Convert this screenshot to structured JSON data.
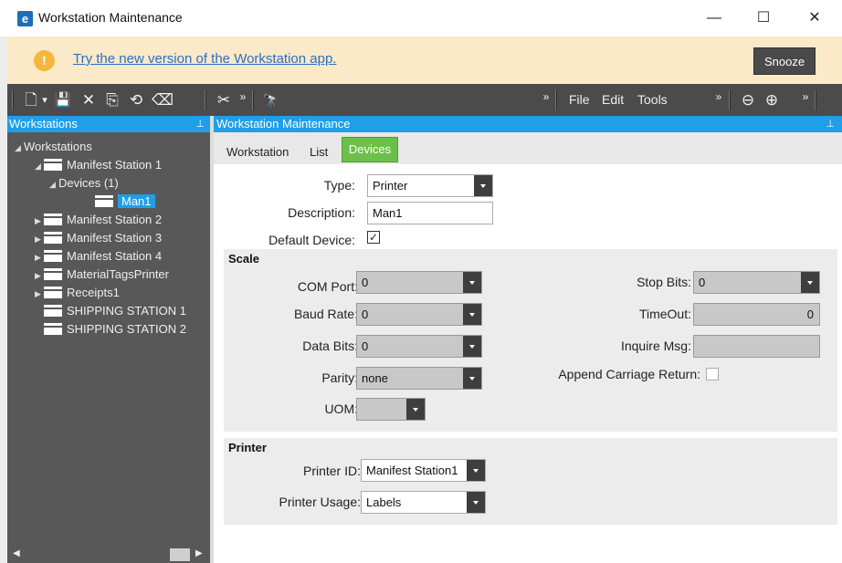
{
  "window": {
    "title": "Workstation Maintenance",
    "logo_letter": "e",
    "minimize": "—",
    "maximize": "☐",
    "close": "✕"
  },
  "notification": {
    "icon": "!",
    "link_text": "Try the new version of the Workstation app.",
    "snooze_label": "Snooze"
  },
  "toolbar": {
    "new_icon": "🗋",
    "dropdown_icon": "▾",
    "save_icon": "💾",
    "delete_icon": "✕",
    "copy_icon": "⎘",
    "refresh_icon": "⟲",
    "clear_icon": "⌫",
    "cut_icon": "✂",
    "overflow1": "»",
    "find_icon": "🔭",
    "overflow2": "»",
    "menu": [
      "File",
      "Edit",
      "Tools"
    ],
    "overflow3": "»",
    "back_icon": "⊖",
    "forward_icon": "⊕",
    "overflow4": "»"
  },
  "workstations_panel": {
    "title": "Workstations",
    "pin": "⊥",
    "tree": [
      {
        "label": "Workstations",
        "level": 0,
        "expand": "◢",
        "folder": false
      },
      {
        "label": "Manifest Station 1",
        "level": 1,
        "expand": "◢",
        "folder": true
      },
      {
        "label": "Devices (1)",
        "level": 2,
        "expand": "◢",
        "folder": false
      },
      {
        "label": "Man1",
        "level": 3,
        "expand": "",
        "folder": true,
        "selected": true
      },
      {
        "label": "Manifest Station 2",
        "level": 1,
        "expand": "▶",
        "folder": true
      },
      {
        "label": "Manifest Station 3",
        "level": 1,
        "expand": "▶",
        "folder": true
      },
      {
        "label": "Manifest Station 4",
        "level": 1,
        "expand": "▶",
        "folder": true
      },
      {
        "label": "MaterialTagsPrinter",
        "level": 1,
        "expand": "▶",
        "folder": true
      },
      {
        "label": "Receipts1",
        "level": 1,
        "expand": "▶",
        "folder": true
      },
      {
        "label": "SHIPPING STATION 1",
        "level": 1,
        "expand": "",
        "folder": true
      },
      {
        "label": "SHIPPING STATION 2",
        "level": 1,
        "expand": "",
        "folder": true
      }
    ],
    "scroll_left": "◀",
    "scroll_right": "▶"
  },
  "maintenance_panel": {
    "title": "Workstation Maintenance",
    "pin": "⊥",
    "tabs": {
      "workstation": "Workstation",
      "list": "List",
      "devices": "Devices"
    },
    "form": {
      "type_label": "Type:",
      "type_value": "Printer",
      "description_label": "Description:",
      "description_value": "Man1",
      "default_label": "Default Device:",
      "default_checked": "✓"
    },
    "scale": {
      "title": "Scale",
      "com_port_label": "COM Port:",
      "com_port_value": "0",
      "baud_rate_label": "Baud Rate:",
      "baud_rate_value": "0",
      "data_bits_label": "Data Bits:",
      "data_bits_value": "0",
      "parity_label": "Parity:",
      "parity_value": "none",
      "uom_label": "UOM:",
      "uom_value": "",
      "stop_bits_label": "Stop Bits:",
      "stop_bits_value": "0",
      "timeout_label": "TimeOut:",
      "timeout_value": "0",
      "inquire_label": "Inquire Msg:",
      "inquire_value": "",
      "append_label": "Append Carriage Return:"
    },
    "printer": {
      "title": "Printer",
      "printer_id_label": "Printer ID:",
      "printer_id_value": "Manifest Station1",
      "usage_label": "Printer Usage:",
      "usage_value": "Labels"
    }
  }
}
